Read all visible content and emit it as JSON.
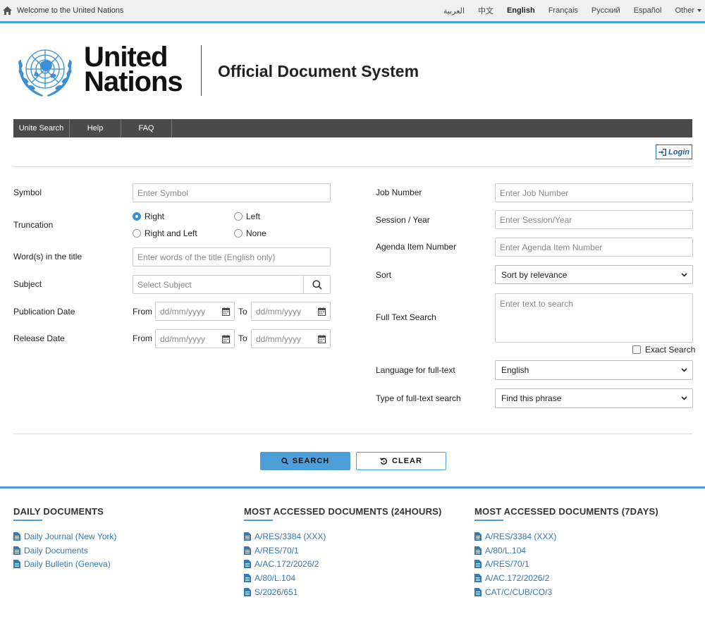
{
  "topbar": {
    "welcome": "Welcome to the United Nations",
    "languages": [
      {
        "label": "العربية",
        "active": false
      },
      {
        "label": "中文",
        "active": false
      },
      {
        "label": "English",
        "active": true
      },
      {
        "label": "Français",
        "active": false
      },
      {
        "label": "Русский",
        "active": false
      },
      {
        "label": "Español",
        "active": false
      },
      {
        "label": "Other",
        "active": false
      }
    ]
  },
  "header": {
    "logo_line1": "United",
    "logo_line2": "Nations",
    "site_title": "Official Document System"
  },
  "nav": {
    "items": [
      "Unite Search",
      "Help",
      "FAQ"
    ]
  },
  "login_label": "Login",
  "form": {
    "symbol": {
      "label": "Symbol",
      "placeholder": "Enter Symbol"
    },
    "truncation": {
      "label": "Truncation",
      "options": [
        "Right",
        "Left",
        "Right and Left",
        "None"
      ],
      "selected": "Right"
    },
    "title_words": {
      "label": "Word(s) in the title",
      "placeholder": "Enter words of the title (English only)"
    },
    "subject": {
      "label": "Subject",
      "placeholder": "Select Subject"
    },
    "publication_date": {
      "label": "Publication Date",
      "from": "From",
      "to": "To",
      "placeholder": "dd/mm/yyyy"
    },
    "release_date": {
      "label": "Release Date",
      "from": "From",
      "to": "To",
      "placeholder": "dd/mm/yyyy"
    },
    "job_number": {
      "label": "Job Number",
      "placeholder": "Enter Job Number"
    },
    "session_year": {
      "label": "Session / Year",
      "placeholder": "Enter Session/Year"
    },
    "agenda_item": {
      "label": "Agenda Item Number",
      "placeholder": "Enter Agenda Item Number"
    },
    "sort": {
      "label": "Sort",
      "value": "Sort by relevance"
    },
    "full_text": {
      "label": "Full Text Search",
      "placeholder": "Enter text to search",
      "exact_label": "Exact Search"
    },
    "language": {
      "label": "Language for full-text",
      "value": "English"
    },
    "type": {
      "label": "Type of full-text search",
      "value": "Find this phrase"
    }
  },
  "buttons": {
    "search": "SEARCH",
    "clear": "CLEAR"
  },
  "footer": {
    "daily": {
      "title": "DAILY DOCUMENTS",
      "items": [
        "Daily Journal (New York)",
        "Daily Documents",
        "Daily Bulletin (Geneva)"
      ]
    },
    "most_24h": {
      "title": "MOST ACCESSED DOCUMENTS (24HOURS)",
      "items": [
        "A/RES/3384 (XXX)",
        "A/RES/70/1",
        "A/AC.172/2026/2",
        "A/80/L.104",
        "S/2026/651"
      ]
    },
    "most_7d": {
      "title": "MOST ACCESSED DOCUMENTS (7DAYS)",
      "items": [
        "A/RES/3384 (XXX)",
        "A/80/L.104",
        "A/RES/70/1",
        "A/AC.172/2026/2",
        "CAT/C/CUB/CO/3"
      ]
    }
  },
  "colors": {
    "accent": "#4d9fda",
    "nav_bg": "#4a4a4a",
    "link": "#3579b5",
    "emblem": "#3b8fd4"
  }
}
